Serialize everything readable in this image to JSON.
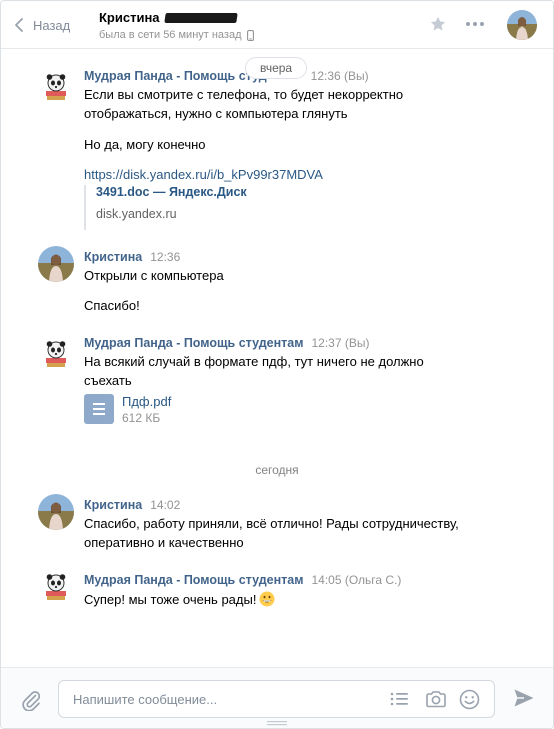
{
  "header": {
    "back_label": "Назад",
    "peer_name": "Кристина",
    "peer_status": "была в сети 56 минут назад"
  },
  "days": {
    "yesterday": "вчера",
    "today": "сегодня"
  },
  "messages": [
    {
      "author": "Мудрая Панда - Помощь студ",
      "time": "12:36 (Вы)",
      "lines": [
        "Если вы смотрите с телефона, то будет некорректно",
        "отображаться, нужно с компьютера глянуть",
        "Но да, могу конечно"
      ],
      "link": "https://disk.yandex.ru/i/b_kPv99r37MDVA",
      "snippet": {
        "title": "3491.doc — Яндекс.Диск",
        "host": "disk.yandex.ru"
      }
    },
    {
      "author": "Кристина",
      "time": "12:36",
      "lines": [
        "Открыли с компьютера",
        "Спасибо!"
      ]
    },
    {
      "author": "Мудрая Панда - Помощь студентам",
      "time": "12:37 (Вы)",
      "lines": [
        "На всякий случай в формате пдф, тут ничего не должно",
        "съехать"
      ],
      "attachment": {
        "name": "Пдф.pdf",
        "size": "612 КБ",
        "icon": "document-icon"
      }
    },
    {
      "author": "Кристина",
      "time": "14:02",
      "lines": [
        "Спасибо, работу приняли, всё отлично! Рады сотрудничеству,",
        "оперативно и качественно"
      ]
    },
    {
      "author": "Мудрая Панда - Помощь студентам",
      "time": "14:05 (Ольга С.)",
      "lines": [
        "Супер! мы тоже очень рады!"
      ]
    }
  ],
  "composer": {
    "placeholder": "Напишите сообщение..."
  },
  "colors": {
    "author": "#42648b",
    "link": "#2a5885",
    "muted": "#939393",
    "accent": "#5181b8"
  },
  "icons": [
    "chevron-left-icon",
    "phone-icon",
    "star-icon",
    "more-icon",
    "paperclip-icon",
    "template-list-icon",
    "camera-icon",
    "smile-icon",
    "send-icon"
  ]
}
